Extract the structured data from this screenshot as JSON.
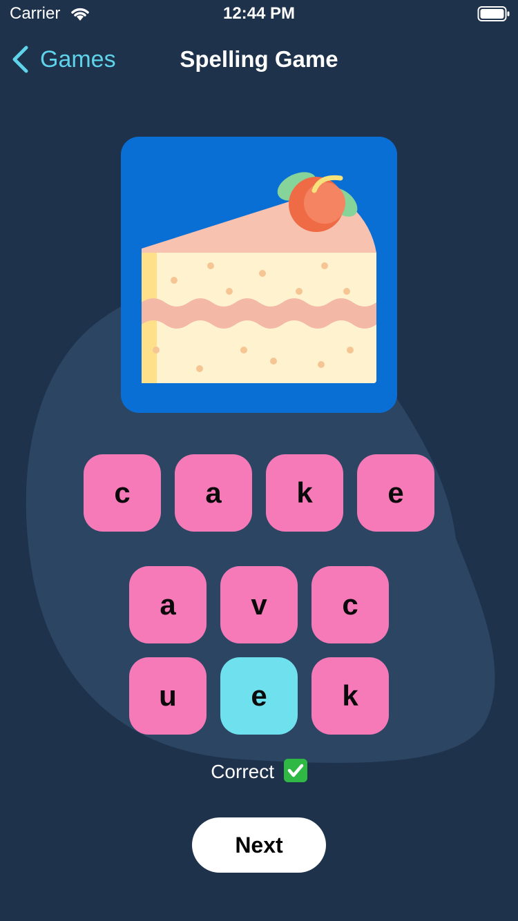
{
  "status_bar": {
    "carrier": "Carrier",
    "time": "12:44 PM"
  },
  "nav": {
    "back_label": "Games",
    "title": "Spelling Game"
  },
  "picture": {
    "subject": "cake-slice-with-strawberry",
    "background_color": "#0a6fd4"
  },
  "answer_tiles": [
    {
      "letter": "c",
      "color": "pink"
    },
    {
      "letter": "a",
      "color": "pink"
    },
    {
      "letter": "k",
      "color": "pink"
    },
    {
      "letter": "e",
      "color": "pink"
    }
  ],
  "letter_choices": [
    {
      "letter": "a",
      "color": "pink"
    },
    {
      "letter": "v",
      "color": "pink"
    },
    {
      "letter": "c",
      "color": "pink"
    },
    {
      "letter": "u",
      "color": "pink"
    },
    {
      "letter": "e",
      "color": "cyan"
    },
    {
      "letter": "k",
      "color": "pink"
    }
  ],
  "feedback": {
    "text": "Correct",
    "icon": "check-mark-icon"
  },
  "next_button": {
    "label": "Next"
  },
  "colors": {
    "background": "#1f324b",
    "blob": "#2b4563",
    "tile_pink": "#f77ab8",
    "tile_cyan": "#6ee0ee",
    "accent": "#5ed3ea"
  }
}
